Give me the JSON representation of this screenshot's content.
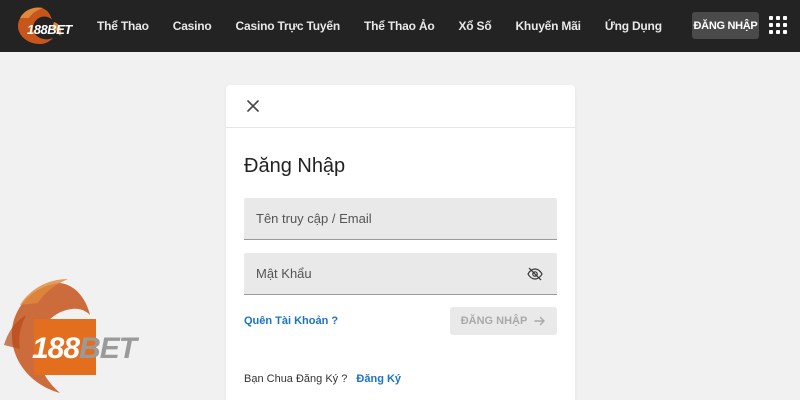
{
  "brand": {
    "logo_text": "188BET",
    "accent": "#e36f1e",
    "header_bg": "#232323"
  },
  "nav": {
    "items": [
      "Thể Thao",
      "Casino",
      "Casino Trực Tuyến",
      "Thể Thao Ảo",
      "Xổ Số",
      "Khuyến Mãi",
      "Ứng Dụng"
    ],
    "login_label": "ĐĂNG NHẬP"
  },
  "icons": {
    "menu": "grid-menu-icon",
    "close": "close-icon",
    "toggle": "eye-slash-icon",
    "arrow": "arrow-right-icon"
  },
  "login": {
    "title": "Đăng Nhập",
    "username": {
      "placeholder": "Tên truy cập / Email",
      "value": ""
    },
    "password": {
      "placeholder": "Mật Khẩu",
      "value": ""
    },
    "forgot_label": "Quên Tài Khoản ?",
    "submit_label": "ĐĂNG NHẬP",
    "no_account_text": "Bạn Chua Đăng Ký ?",
    "signup_label": "Đăng Ký",
    "link_color": "#1a73c7"
  },
  "watermark": {
    "text_a": "188",
    "text_b": "BET"
  }
}
